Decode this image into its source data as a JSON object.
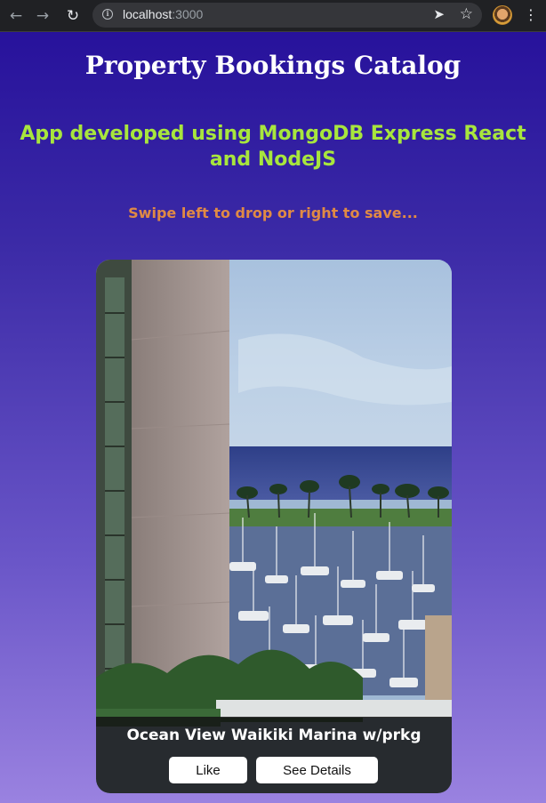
{
  "browser": {
    "url_host": "localhost",
    "url_port": ":3000",
    "icons": {
      "back": "arrow-left-icon",
      "forward": "arrow-right-icon",
      "reload": "reload-icon",
      "info": "info-icon",
      "send": "send-icon",
      "bookmark": "star-icon",
      "menu": "kebab-menu-icon"
    }
  },
  "header": {
    "title": "Property Bookings Catalog",
    "subtitle": "App developed using MongoDB Express React and NodeJS",
    "instructions": "Swipe left to drop or right to save..."
  },
  "card": {
    "title": "Ocean View Waikiki Marina w/prkg",
    "like_label": "Like",
    "details_label": "See Details"
  },
  "colors": {
    "title": "#ffffff",
    "subtitle": "#a8e63d",
    "instructions": "#e08a45",
    "background_top": "#240e9a",
    "background_bottom": "#9a82e0"
  }
}
